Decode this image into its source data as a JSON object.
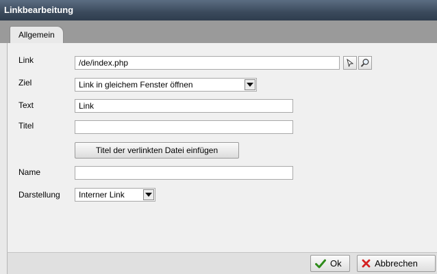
{
  "window": {
    "title": "Linkbearbeitung"
  },
  "tabs": [
    {
      "label": "Allgemein",
      "active": true
    }
  ],
  "form": {
    "link": {
      "label": "Link",
      "value": "/de/index.php"
    },
    "ziel": {
      "label": "Ziel",
      "value": "Link in gleichem Fenster öffnen"
    },
    "text": {
      "label": "Text",
      "value": "Link"
    },
    "titel": {
      "label": "Titel",
      "value": ""
    },
    "insert_title_button": "Titel der verlinkten Datei einfügen",
    "name": {
      "label": "Name",
      "value": ""
    },
    "darstellung": {
      "label": "Darstellung",
      "value": "Interner Link"
    }
  },
  "icons": {
    "link_pick": "cursor-arrow-icon",
    "link_search": "magnifier-icon",
    "ok": "checkmark-icon",
    "cancel": "x-icon"
  },
  "footer": {
    "ok_label": "Ok",
    "cancel_label": "Abbrechen"
  },
  "colors": {
    "titlebar": "#3b4a5c",
    "ok_icon": "#2e8b1a",
    "cancel_icon": "#d42020"
  }
}
